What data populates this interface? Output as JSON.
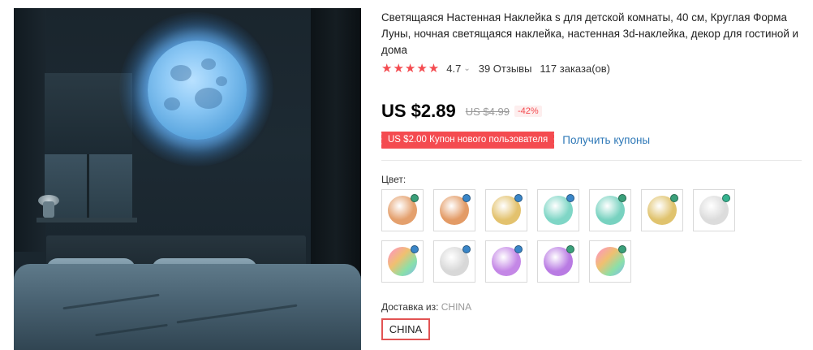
{
  "product": {
    "title": "Светящаяся Настенная Наклейка s для детской комнаты, 40 см, Круглая Форма Луны, ночная светящаяся наклейка, настенная 3d-наклейка, декор для гостиной и дома",
    "stars": "★★★★★",
    "rating": "4.7",
    "reviews": "39 Отзывы",
    "orders": "117 заказа(ов)"
  },
  "price": {
    "current": "US $2.89",
    "old": "US $4.99",
    "discount": "-42%"
  },
  "coupon": {
    "badge": "US $2.00 Купон нового пользователя",
    "link": "Получить купоны"
  },
  "color": {
    "label": "Цвет:",
    "swatches": [
      {
        "name": "orange",
        "ball": "#e4a06d",
        "dot": "#3aa07a"
      },
      {
        "name": "orange",
        "ball": "#e39b66",
        "dot": "#3a86c8"
      },
      {
        "name": "yellow",
        "ball": "#e3c26e",
        "dot": "#3a86c8"
      },
      {
        "name": "teal",
        "ball": "#7fd6c6",
        "dot": "#3a86c8"
      },
      {
        "name": "teal",
        "ball": "#78d2c0",
        "dot": "#3aa07a"
      },
      {
        "name": "yellow",
        "ball": "#e0c36e",
        "dot": "#3aa07a"
      },
      {
        "name": "white",
        "ball": "#dcdcdc",
        "dot": "#36b38f"
      },
      {
        "name": "rainbow",
        "ball": "#ee7fc0",
        "dot": "#3a86c8"
      },
      {
        "name": "white",
        "ball": "#d8d8d8",
        "dot": "#3a86c8"
      },
      {
        "name": "purple",
        "ball": "#c487e6",
        "dot": "#3a86c8"
      },
      {
        "name": "purple",
        "ball": "#b97be3",
        "dot": "#3aa07a"
      },
      {
        "name": "rainbow",
        "ball": "#ef87b0",
        "dot": "#3aa07a"
      }
    ]
  },
  "shipping": {
    "label": "Доставка из:",
    "value": "CHINA",
    "option": "CHINA"
  }
}
